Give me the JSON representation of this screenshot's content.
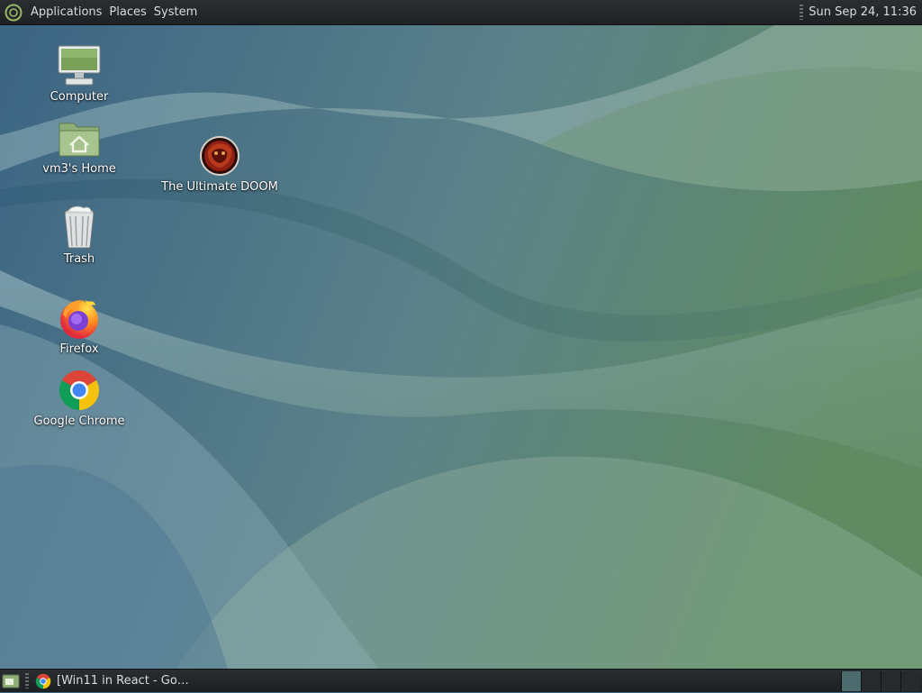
{
  "top_panel": {
    "menus": [
      "Applications",
      "Places",
      "System"
    ],
    "clock": "Sun Sep 24, 11:36"
  },
  "desktop": {
    "icons": [
      {
        "label": "Computer",
        "icon": "computer-monitor-icon"
      },
      {
        "label": "vm3's Home",
        "icon": "home-folder-icon"
      },
      {
        "label": "Trash",
        "icon": "trash-can-icon"
      },
      {
        "label": "Firefox",
        "icon": "firefox-icon"
      },
      {
        "label": "Google Chrome",
        "icon": "chrome-icon"
      },
      {
        "label": "The Ultimate DOOM",
        "icon": "doom-icon"
      }
    ]
  },
  "bottom_panel": {
    "tasks": [
      {
        "label": "[Win11 in React - Go…",
        "icon": "chrome-icon"
      }
    ],
    "workspace_count": 4,
    "active_workspace": 1
  },
  "colors": {
    "panel": "#1f2224",
    "wallpaper_blue": "#3f6880",
    "wallpaper_green": "#6b9070"
  }
}
